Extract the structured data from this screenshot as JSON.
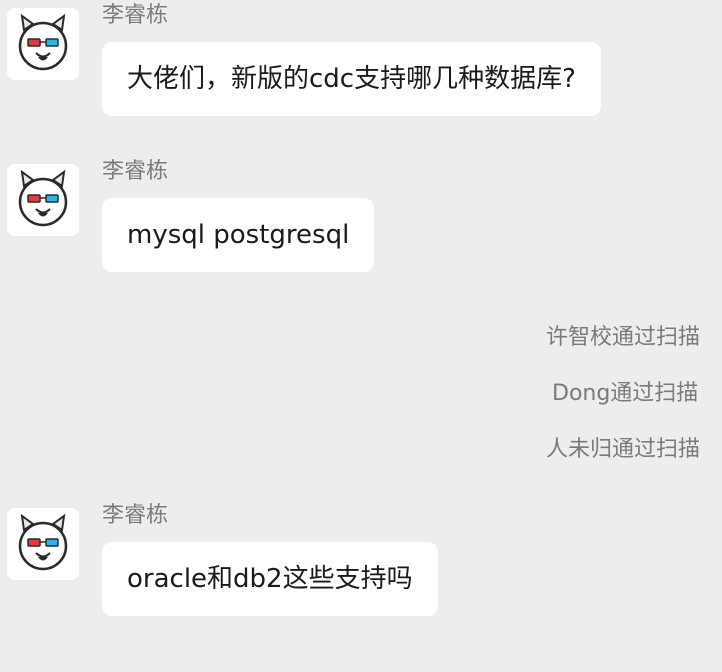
{
  "messages": [
    {
      "sender": "李睿栋",
      "text": "大佬们，新版的cdc支持哪几种数据库?"
    },
    {
      "sender": "李睿栋",
      "text": "mysql postgresql"
    },
    {
      "sender": "李睿栋",
      "text": "oracle和db2这些支持吗"
    }
  ],
  "system_notices": [
    "许智校通过扫描",
    "Dong通过扫描",
    "人未归通过扫描"
  ],
  "avatar_icon": "cartoon-cat-with-3d-glasses-icon"
}
